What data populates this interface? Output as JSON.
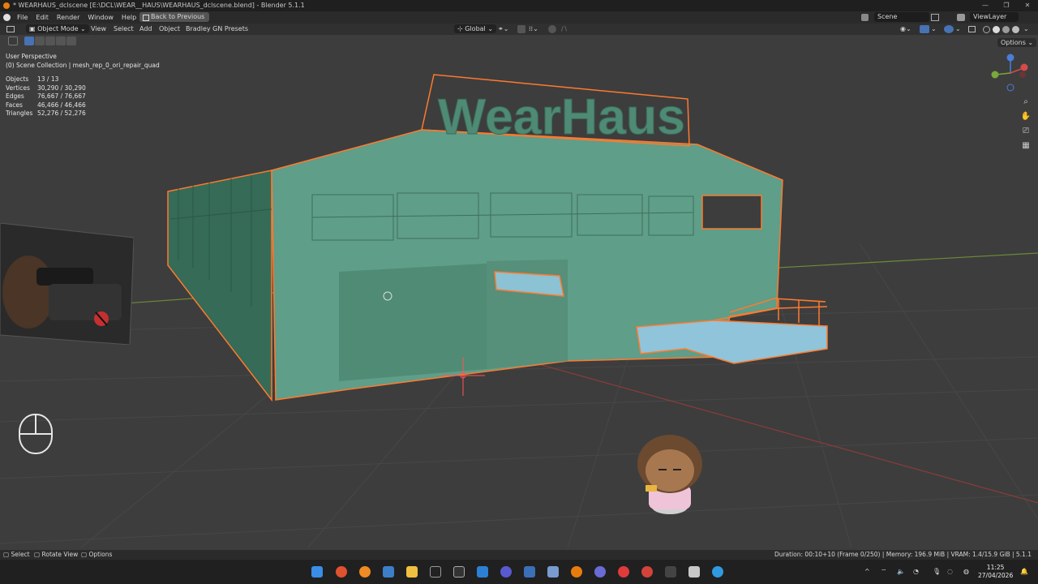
{
  "window": {
    "title": "* WEARHAUS_dclscene [E:\\DCL\\WEAR__HAUS\\WEARHAUS_dclscene.blend] - Blender 5.1.1",
    "controls": [
      "—",
      "❐",
      "✕"
    ]
  },
  "menu": {
    "items": [
      "File",
      "Edit",
      "Render",
      "Window",
      "Help"
    ],
    "back_button": "Back to Previous",
    "scene_label": "Scene",
    "view_layer_label": "ViewLayer"
  },
  "viewport_header": {
    "mode": "Object Mode",
    "menus": [
      "View",
      "Select",
      "Add",
      "Object",
      "Bradley GN Presets"
    ],
    "transform_orientation": "Global",
    "options_label": "Options"
  },
  "viewport_info": {
    "perspective": "User Perspective",
    "collection": "(0) Scene Collection | mesh_rep_0_ori_repair_quad",
    "stats": [
      {
        "label": "Objects",
        "value": "13 / 13"
      },
      {
        "label": "Vertices",
        "value": "30,290 / 30,290"
      },
      {
        "label": "Edges",
        "value": "76,667 / 76,667"
      },
      {
        "label": "Faces",
        "value": "46,466 / 46,466"
      },
      {
        "label": "Triangles",
        "value": "52,276 / 52,276"
      }
    ]
  },
  "scene_objects": {
    "sign_text": "WearHaus"
  },
  "gizmo": {
    "x": "X",
    "y": "Y",
    "z": "Z"
  },
  "statusbar": {
    "select": "Select",
    "rotate": "Rotate View",
    "options": "Options",
    "info": "Duration: 00:10+10 (Frame 0/250) | Memory: 196.9 MiB | VRAM: 1.4/15.9 GiB | 5.1.1"
  },
  "taskbar": {
    "time": "11:25",
    "date": "27/04/2026",
    "tray_chevron": "^"
  },
  "colors": {
    "accent": "#4772b3",
    "building": "#5f9e88",
    "selection": "#ff7a2e",
    "viewport_bg": "#3d3d3d"
  }
}
